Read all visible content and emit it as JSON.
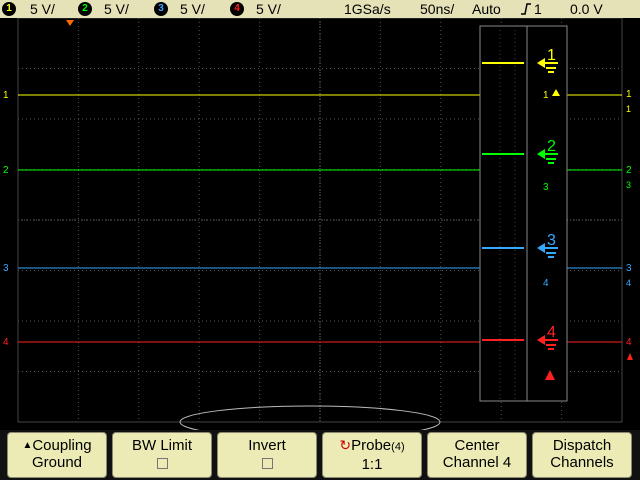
{
  "status_bar": {
    "channels": [
      {
        "num": "1",
        "scale": "5 V/",
        "color": "#ffff00"
      },
      {
        "num": "2",
        "scale": "5 V/",
        "color": "#00ff00"
      },
      {
        "num": "3",
        "scale": "5 V/",
        "color": "#33aaff"
      },
      {
        "num": "4",
        "scale": "5 V/",
        "color": "#ff2020"
      }
    ],
    "sample_rate": "1GSa/s",
    "timebase": "50ns/",
    "trigger_mode": "Auto",
    "trigger_edge_icon": "rising-edge-icon",
    "trigger_source": "1",
    "trigger_level": "0.0 V"
  },
  "traces": [
    {
      "name": "1",
      "color": "#ffff00",
      "level_label": "1"
    },
    {
      "name": "2",
      "color": "#00ff00",
      "level_label": "3"
    },
    {
      "name": "3",
      "color": "#33aaff",
      "level_label": "4"
    },
    {
      "name": "4",
      "color": "#ff2020",
      "level_label": ""
    }
  ],
  "softkeys": {
    "coupling": {
      "label": "Coupling",
      "value": "Ground"
    },
    "bw_limit": {
      "label": "BW Limit"
    },
    "invert": {
      "label": "Invert"
    },
    "probe": {
      "label": "Probe",
      "badge": "4",
      "value": "1:1"
    },
    "center": {
      "label": "Center",
      "value": "Channel 4"
    },
    "dispatch": {
      "label": "Dispatch",
      "value": "Channels"
    }
  }
}
